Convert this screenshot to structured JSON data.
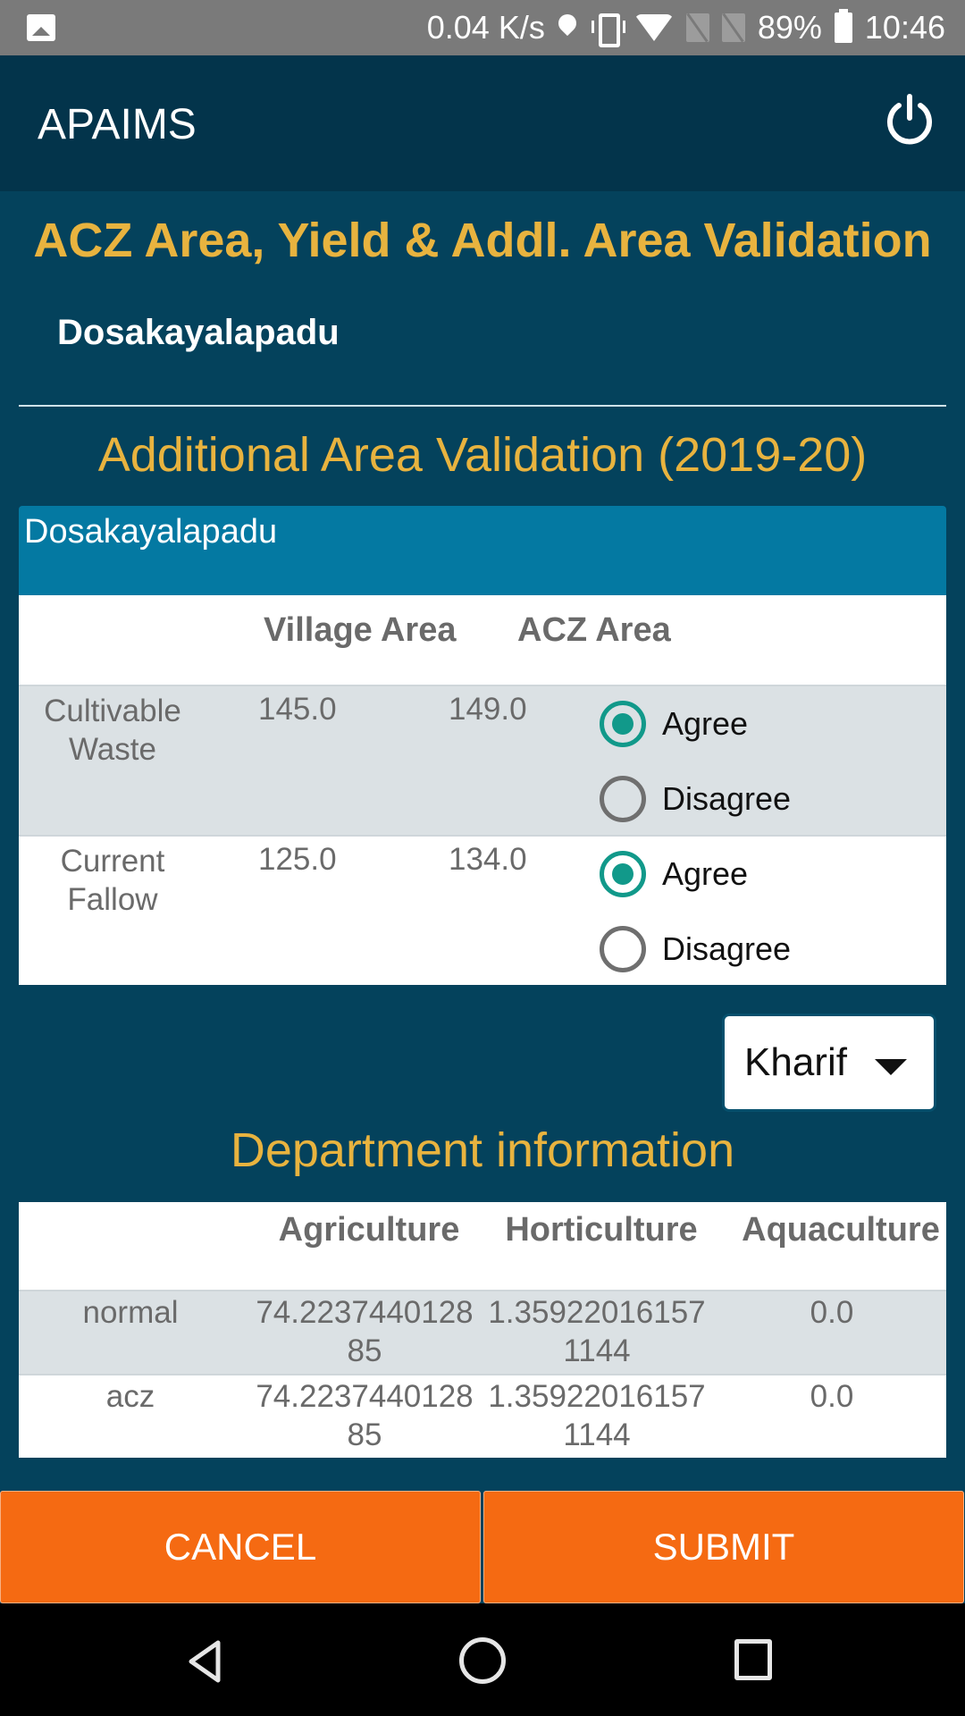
{
  "status_bar": {
    "net_speed": "0.04 K/s",
    "battery": "89%",
    "time": "10:46",
    "icons": [
      "gallery-icon",
      "location-icon",
      "vibrate-icon",
      "wifi-icon",
      "no-sim-icon",
      "no-sim-icon",
      "battery-icon"
    ]
  },
  "app_bar": {
    "title": "APAIMS",
    "power_icon": "power-icon"
  },
  "page": {
    "title": "ACZ Area, Yield & Addl. Area Validation",
    "village": "Dosakayalapadu"
  },
  "area_validation": {
    "title": "Additional Area Validation (2019-20)",
    "card_header": "Dosakayalapadu",
    "columns": [
      "",
      "Village Area",
      "ACZ Area",
      ""
    ],
    "rows": [
      {
        "label": "Cultivable Waste",
        "village_area": "145.0",
        "acz_area": "149.0",
        "options": [
          "Agree",
          "Disagree"
        ],
        "selected": "Agree"
      },
      {
        "label": "Current Fallow",
        "village_area": "125.0",
        "acz_area": "134.0",
        "options": [
          "Agree",
          "Disagree"
        ],
        "selected": "Agree"
      }
    ]
  },
  "season_select": {
    "value": "Kharif"
  },
  "department": {
    "title": "Department information",
    "columns": [
      "",
      "Agriculture",
      "Horticulture",
      "Aquaculture"
    ],
    "rows": [
      {
        "label": "normal",
        "agriculture": "74.223744012885",
        "horticulture": "1.359220161571144",
        "aquaculture": "0.0"
      },
      {
        "label": "acz",
        "agriculture": "74.223744012885",
        "horticulture": "1.359220161571144",
        "aquaculture": "0.0"
      }
    ]
  },
  "actions": {
    "cancel": "CANCEL",
    "submit": "SUBMIT"
  },
  "colors": {
    "accent_gold": "#e8b33f",
    "app_bar": "#03344b",
    "background": "#04425c",
    "card_header": "#0479a2",
    "radio_selected": "#11998a",
    "button": "#f56a12"
  }
}
